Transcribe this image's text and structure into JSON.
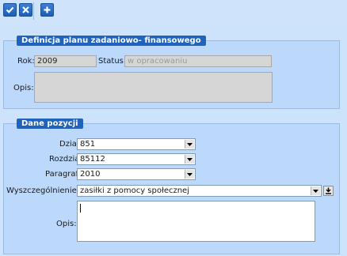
{
  "toolbar": {
    "buttons": [
      {
        "name": "confirm",
        "icon": "check-icon"
      },
      {
        "name": "cancel",
        "icon": "close-icon"
      },
      {
        "name": "add",
        "icon": "plus-icon"
      }
    ]
  },
  "section_plan": {
    "title": "Definicja planu zadaniowo- finansowego",
    "rok_label": "Rok:",
    "rok_value": "2009",
    "status_label": "Status:",
    "status_value": "w opracowaniu",
    "opis_label": "Opis:",
    "opis_value": ""
  },
  "section_position": {
    "title": "Dane pozycji",
    "dzial_label": "Dział:",
    "dzial_value": "851",
    "rozdzial_label": "Rozdział:",
    "rozdzial_value": "85112",
    "paragraf_label": "Paragraf:",
    "paragraf_value": "2010",
    "wyszczegolnienie_label": "Wyszczególnienie:",
    "wyszczegolnienie_value": "zasiłki z pomocy społecznej",
    "opis_label": "Opis:",
    "opis_value": ""
  },
  "colors": {
    "accent": "#1f63bd",
    "panel_bg": "#bcd8fa",
    "toolbar_bg": "#cfe3fb"
  }
}
